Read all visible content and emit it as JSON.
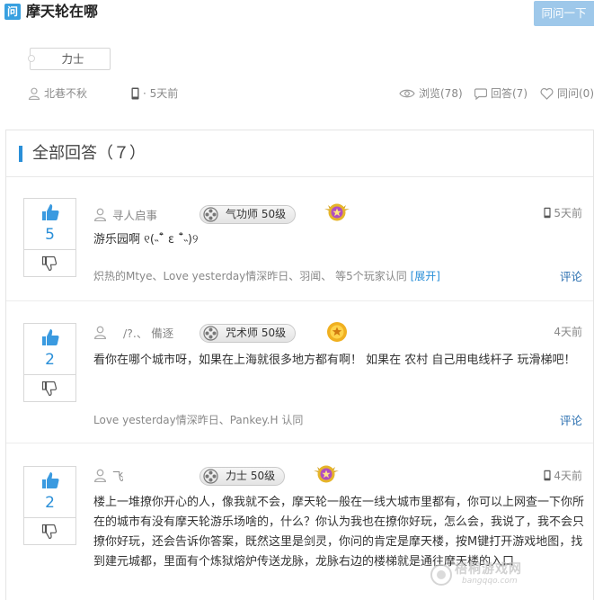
{
  "question": {
    "icon_letter": "问",
    "title": "摩天轮在哪",
    "same_question_label": "同问一下",
    "tag": "力士",
    "author": "北巷不秋",
    "device_time": "· 5天前",
    "views": "浏览(78)",
    "answers_count": "回答(7)",
    "same_count": "同问(0)"
  },
  "answers_header": {
    "title": "全部回答（７）"
  },
  "answers": [
    {
      "votes": "5",
      "username": "寻人启事",
      "level": "气功师 50级",
      "time": "5天前",
      "content": "游乐园啊 ୧(˵¯͒ ε ¯͒˵)୨",
      "approvers": "炽热的Mtye、Love yesterday情深昨日、羽闻、 等5个玩家认同",
      "expand": "[展开]",
      "comment": "评论"
    },
    {
      "votes": "2",
      "username": "/?.、 備逐",
      "level": "咒术师 50级",
      "time": "4天前",
      "content": "看你在哪个城市呀，如果在上海就很多地方都有啊！ 如果在 农村 自己用电线杆子 玩滑梯吧！",
      "approvers": "Love yesterday情深昨日、Pankey.H 认同",
      "comment": "评论"
    },
    {
      "votes": "2",
      "username": "飞",
      "level": "力士 50级",
      "time": "4天前",
      "content": "楼上一堆撩你开心的人，像我就不会，摩天轮一般在一线大城市里都有，你可以上网查一下你所在的城市有没有摩天轮游乐场啥的，什么？你认为我也在撩你好玩，怎么会，我说了，我不会只撩你好玩，还会告诉你答案，既然这里是剑灵，你问的肯定是摩天楼，按M键打开游戏地图，找到建元城都，里面有个炼狱熔炉传送龙脉，龙脉右边的楼梯就是通往摩天楼的入口"
    }
  ],
  "watermark": {
    "text": "梧桐游戏网",
    "sub": "bangqqo.com"
  },
  "colors": {
    "accent": "#2a8fd8",
    "button": "#9ec8ea",
    "icon_blue": "#38a0e0"
  }
}
